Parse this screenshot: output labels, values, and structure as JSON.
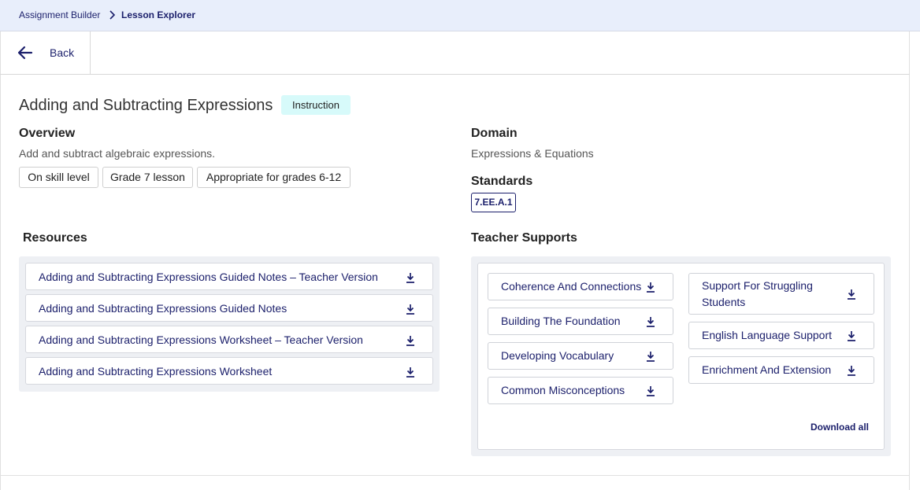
{
  "breadcrumb": {
    "parent": "Assignment Builder",
    "current": "Lesson Explorer"
  },
  "nav": {
    "back_label": "Back"
  },
  "lesson": {
    "title": "Adding and Subtracting Expressions",
    "type_badge": "Instruction",
    "overview_heading": "Overview",
    "overview_text": "Add and subtract algebraic expressions.",
    "tags": [
      "On skill level",
      "Grade 7 lesson",
      "Appropriate for grades 6-12"
    ],
    "domain_heading": "Domain",
    "domain_text": "Expressions & Equations",
    "standards_heading": "Standards",
    "standards": [
      "7.EE.A.1"
    ]
  },
  "resources": {
    "heading": "Resources",
    "items": [
      "Adding and Subtracting Expressions Guided Notes – Teacher Version",
      "Adding and Subtracting Expressions Guided Notes",
      "Adding and Subtracting Expressions Worksheet – Teacher Version",
      "Adding and Subtracting Expressions Worksheet"
    ]
  },
  "teacher_supports": {
    "heading": "Teacher Supports",
    "left": [
      "Coherence And Connections",
      "Building The Foundation",
      "Developing Vocabulary",
      "Common Misconceptions"
    ],
    "right": [
      "Support For Struggling Students",
      "English Language Support",
      "Enrichment And Extension"
    ],
    "download_all_label": "Download all"
  },
  "icons": {
    "back": "arrow-left-icon",
    "separator": "chevron-right-icon",
    "download": "download-icon"
  },
  "colors": {
    "brand_navy": "#1b1f6b",
    "breadcrumb_bg": "#e8eefb",
    "badge_bg": "#d7fafa",
    "panel_bg": "#eef0f4"
  }
}
